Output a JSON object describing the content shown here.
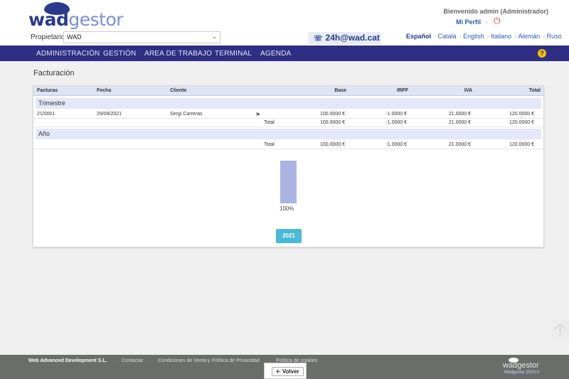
{
  "header": {
    "logo_left": "wad",
    "logo_right": "gestor",
    "propietario_label": "Propietario",
    "propietario_value": "WAD",
    "phone": "24h@wad.cat",
    "welcome": "Bienvenido admin (Administrador)",
    "mi_perfil": "Mi Perfil",
    "sep": "-",
    "languages": [
      "Español",
      "Català",
      "English",
      "Italiano",
      "Alemán",
      "Ruso"
    ]
  },
  "nav": {
    "items": [
      "ADMINISTRACIÓN",
      "GESTIÓN",
      "AREA DE TRABAJO",
      "TERMINAL",
      "AGENDA"
    ]
  },
  "page": {
    "title": "Facturación",
    "columns": [
      "Facturas",
      "Fecha",
      "Cliente",
      "Base",
      "IRPF",
      "IVA",
      "Total"
    ],
    "trimestre": {
      "label": "Trimestre",
      "rows": [
        {
          "factura": "21/0001",
          "fecha": "29/09/2021",
          "cliente": "Sergi Carreras",
          "base": "100.0000 €",
          "irpf": "-1.0000 €",
          "iva": "21.0000 €",
          "total": "120.0000 €"
        }
      ],
      "total_label": "Total",
      "total": {
        "base": "100.0000 €",
        "irpf": "-1.0000 €",
        "iva": "21.0000 €",
        "total": "120.0000 €"
      }
    },
    "ano": {
      "label": "Año",
      "total_label": "Total",
      "total": {
        "base": "100.0000 €",
        "irpf": "-1.0000 €",
        "iva": "21.0000 €",
        "total": "120.0000 €"
      }
    },
    "chart_percent": "100%",
    "chart_fraction": 1.0,
    "year_button": "2021"
  },
  "footer": {
    "company": "Web Advanced Development S.L.",
    "links": [
      "Contactar",
      "Condiciones de Venta y Política de Privacidad",
      "Política de cookies"
    ],
    "logo": "wadgestor",
    "version": "Wadgestor 2020.0",
    "volver": "Volver"
  },
  "colors": {
    "nav": "#2e2f84",
    "brand": "#2b3a8c",
    "year_button": "#48b9d6",
    "bar": "#aab4e3",
    "footer": "#6b6d6b"
  }
}
